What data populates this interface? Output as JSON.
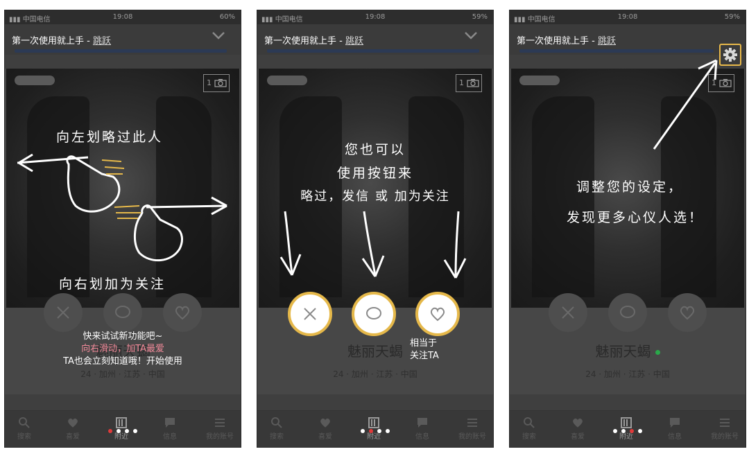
{
  "shared": {
    "status": {
      "carrier": "▮▮▮ 中国电信",
      "time": "19:08"
    },
    "guide": {
      "title": "第一次使用就上手 - ",
      "skip": "跳跃"
    },
    "profile": {
      "name": "魅丽天蝎",
      "info": "24 · 加州 · 江苏 · 中国"
    },
    "photo_count": "1",
    "tabs": [
      "搜索",
      "喜爱",
      "附近",
      "信息",
      "我的账号"
    ]
  },
  "panel1": {
    "battery": "60%",
    "swipe_left": "向左划略过此人",
    "swipe_right": "向右划加为关注",
    "note_line1": "快来试试新功能吧~",
    "note_line2": "向右滑动，加TA最爱",
    "note_line3": "TA也会立刻知道哦！开始使用"
  },
  "panel2": {
    "battery": "59%",
    "line1": "您也可以",
    "line2": "使用按钮来",
    "line3": "略过，发信 或 加为关注",
    "like_hint_line1": "相当于",
    "like_hint_line2": "关注TA"
  },
  "panel3": {
    "battery": "59%",
    "line1": "调整您的设定，",
    "line2": "发现更多心仪人选！"
  },
  "colors": {
    "accent_gold": "#e5b84a",
    "online_green": "#2aa84a",
    "active_dot": "#e03a3a"
  },
  "icons": [
    "gear-icon",
    "close-icon",
    "chat-icon",
    "heart-icon",
    "camera-icon",
    "search-icon",
    "chevron-down-icon"
  ]
}
